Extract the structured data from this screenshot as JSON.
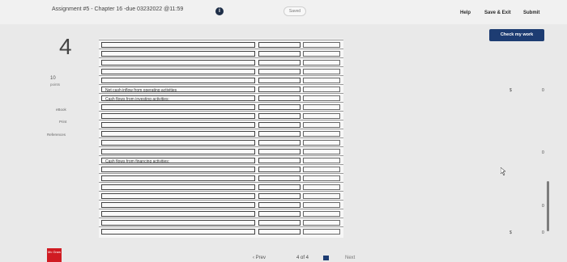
{
  "header": {
    "assignment_title": "Assignment #5 - Chapter 16 -due 03232022 @11:59",
    "saved": "Saved",
    "help": "Help",
    "save_exit": "Save & Exit",
    "submit": "Submit"
  },
  "buttons": {
    "check_my_work": "Check my work"
  },
  "question": {
    "number": "4",
    "points_value": "10",
    "points_label": "points"
  },
  "sidebar": {
    "ebook": "eBook",
    "print": "Print",
    "references": "References"
  },
  "table": {
    "rows": [
      {
        "label": "",
        "amount": "",
        "dollar": "",
        "value": ""
      },
      {
        "label": "",
        "amount": "",
        "dollar": "",
        "value": ""
      },
      {
        "label": "",
        "amount": "",
        "dollar": "",
        "value": ""
      },
      {
        "label": "",
        "amount": "",
        "dollar": "",
        "value": ""
      },
      {
        "label": "",
        "amount": "",
        "dollar": "",
        "value": ""
      },
      {
        "label": "Net cash inflow from operating activities",
        "amount": "",
        "dollar": "$",
        "value": "0"
      },
      {
        "label": "Cash flows from investing activities:",
        "amount": "",
        "dollar": "",
        "value": ""
      },
      {
        "label": "",
        "amount": "",
        "dollar": "",
        "value": ""
      },
      {
        "label": "",
        "amount": "",
        "dollar": "",
        "value": ""
      },
      {
        "label": "",
        "amount": "",
        "dollar": "",
        "value": ""
      },
      {
        "label": "",
        "amount": "",
        "dollar": "",
        "value": ""
      },
      {
        "label": "",
        "amount": "",
        "dollar": "",
        "value": ""
      },
      {
        "label": "",
        "amount": "",
        "dollar": "",
        "value": "0"
      },
      {
        "label": "Cash flows from financing activities:",
        "amount": "",
        "dollar": "",
        "value": ""
      },
      {
        "label": "",
        "amount": "",
        "dollar": "",
        "value": ""
      },
      {
        "label": "",
        "amount": "",
        "dollar": "",
        "value": ""
      },
      {
        "label": "",
        "amount": "",
        "dollar": "",
        "value": ""
      },
      {
        "label": "",
        "amount": "",
        "dollar": "",
        "value": ""
      },
      {
        "label": "",
        "amount": "",
        "dollar": "",
        "value": "0"
      },
      {
        "label": "",
        "amount": "",
        "dollar": "",
        "value": ""
      },
      {
        "label": "",
        "amount": "",
        "dollar": "",
        "value": ""
      },
      {
        "label": "",
        "amount": "",
        "dollar": "$",
        "value": "0"
      }
    ]
  },
  "navigation": {
    "prev": "Prev",
    "page": "4 of 4",
    "next": "Next"
  },
  "logo": {
    "text": "Mc Graw"
  },
  "colors": {
    "accent": "#1d3c72",
    "logo": "#d01b22"
  }
}
